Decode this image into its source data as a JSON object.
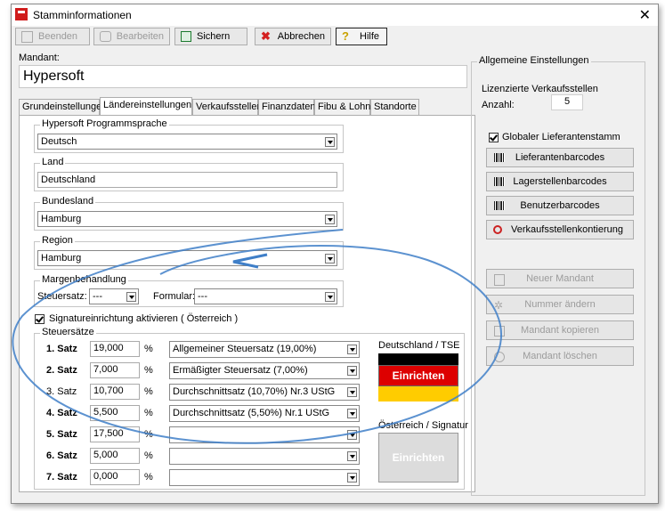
{
  "window": {
    "title": "Stamminformationen"
  },
  "toolbar": [
    {
      "label": "Beenden",
      "icon": "exit-icon",
      "enabled": false
    },
    {
      "label": "Bearbeiten",
      "icon": "edit-icon",
      "enabled": false
    },
    {
      "label": "Sichern",
      "icon": "save-icon",
      "enabled": true
    },
    {
      "label": "Abbrechen",
      "icon": "cancel-icon",
      "enabled": true
    },
    {
      "label": "Hilfe",
      "icon": "help-icon",
      "enabled": true
    }
  ],
  "mandant": {
    "label": "Mandant:",
    "value": "Hypersoft"
  },
  "tabs": [
    "Grundeinstellungen",
    "Ländereinstellungen",
    "Verkaufsstellen",
    "Finanzdaten",
    "Fibu & Lohn",
    "Standorte"
  ],
  "laender": {
    "sprache": {
      "label": "Hypersoft Programmsprache",
      "value": "Deutsch"
    },
    "land": {
      "label": "Land",
      "value": "Deutschland"
    },
    "bundesland": {
      "label": "Bundesland",
      "value": "Hamburg"
    },
    "region": {
      "label": "Region",
      "value": "Hamburg"
    },
    "marge": {
      "label": "Margenbehandlung",
      "steuersatz_label": "Steuersatz:",
      "steuersatz_value": "---",
      "formular_label": "Formular:",
      "formular_value": "---"
    },
    "signatur": {
      "label": "Signatureinrichtung aktivieren ( Österreich )",
      "checked": true
    }
  },
  "steuersaetze": {
    "label": "Steuersätze",
    "rows": [
      {
        "label": "1. Satz",
        "value": "19,000",
        "desc": "Allgemeiner Steuersatz (19,00%)"
      },
      {
        "label": "2. Satz",
        "value": "7,000",
        "desc": "Ermäßigter Steuersatz (7,00%)"
      },
      {
        "label": "3. Satz",
        "value": "10,700",
        "desc": "Durchschnittsatz (10,70%) Nr.3 UStG"
      },
      {
        "label": "4. Satz",
        "value": "5,500",
        "desc": "Durchschnittsatz (5,50%) Nr.1 UStG"
      },
      {
        "label": "5. Satz",
        "value": "17,500",
        "desc": ""
      },
      {
        "label": "6. Satz",
        "value": "5,000",
        "desc": ""
      },
      {
        "label": "7. Satz",
        "value": "0,000",
        "desc": ""
      }
    ],
    "pct": "%"
  },
  "tse": {
    "label": "Deutschland / TSE",
    "button": "Einrichten",
    "flag": [
      "#000000",
      "#dd0000",
      "#ffcc00"
    ]
  },
  "at": {
    "label": "Österreich / Signatur",
    "button": "Einrichten"
  },
  "allgemein": {
    "label": "Allgemeine Einstellungen",
    "lizenz_label": "Lizenzierte Verkaufsstellen",
    "anzahl_label": "Anzahl:",
    "anzahl": "5",
    "global_label": "Globaler Lieferantenstamm",
    "buttons": [
      "Lieferantenbarcodes",
      "Lagerstellenbarcodes",
      "Benutzerbarcodes",
      "Verkaufsstellenkontierung"
    ],
    "mandant_buttons": [
      "Neuer Mandant",
      "Nummer ändern",
      "Mandant kopieren",
      "Mandant löschen"
    ]
  }
}
